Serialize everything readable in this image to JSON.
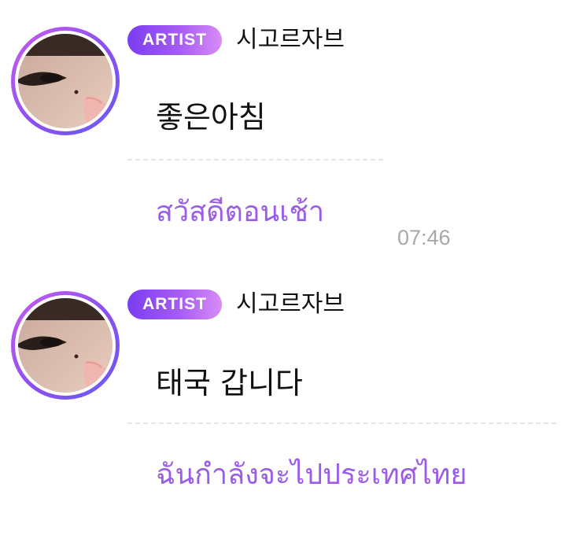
{
  "messages": [
    {
      "badge": "ARTIST",
      "author": "시고르자브",
      "text": "좋은아침",
      "translation": "สวัสดีตอนเช้า",
      "time": "07:46"
    },
    {
      "badge": "ARTIST",
      "author": "시고르자브",
      "text": "태국 갑니다",
      "translation": "ฉันกำลังจะไปประเทศไทย"
    }
  ],
  "colors": {
    "badge_gradient": [
      "#7b3df2",
      "#d78cf6"
    ],
    "translation": "#9b5ce6",
    "timestamp": "#a8a8a8"
  }
}
